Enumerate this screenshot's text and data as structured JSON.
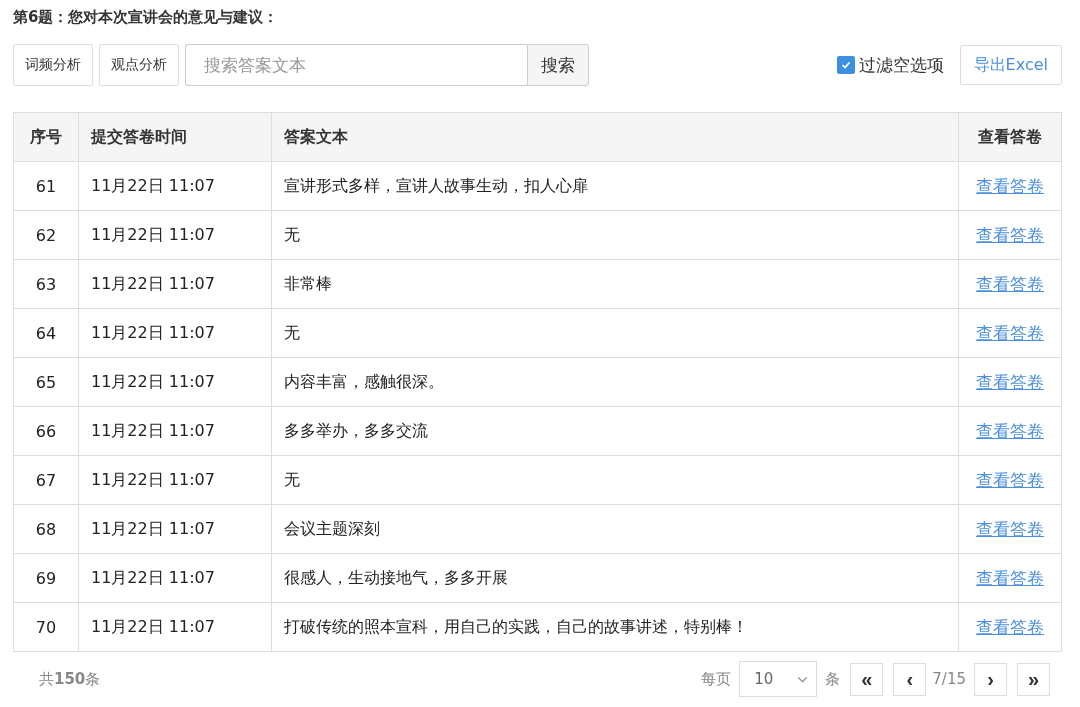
{
  "question_title": "第6题：您对本次宣讲会的意见与建议：",
  "toolbar": {
    "buttons": [
      "词频分析",
      "观点分析"
    ],
    "search": {
      "placeholder": "搜索答案文本",
      "button": "搜索"
    },
    "filter": {
      "label": "过滤空选项",
      "checked": true
    },
    "export_button": "导出Excel"
  },
  "table": {
    "columns": [
      "序号",
      "提交答卷时间",
      "答案文本",
      "查看答卷"
    ],
    "rows": [
      {
        "index": "61",
        "time": "11月22日 11:07",
        "answer": "宣讲形式多样，宣讲人故事生动，扣人心扉",
        "link": "查看答卷"
      },
      {
        "index": "62",
        "time": "11月22日 11:07",
        "answer": "无",
        "link": "查看答卷"
      },
      {
        "index": "63",
        "time": "11月22日 11:07",
        "answer": "非常棒",
        "link": "查看答卷"
      },
      {
        "index": "64",
        "time": "11月22日 11:07",
        "answer": "无",
        "link": "查看答卷"
      },
      {
        "index": "65",
        "time": "11月22日 11:07",
        "answer": "内容丰富，感触很深。",
        "link": "查看答卷"
      },
      {
        "index": "66",
        "time": "11月22日 11:07",
        "answer": "多多举办，多多交流",
        "link": "查看答卷"
      },
      {
        "index": "67",
        "time": "11月22日 11:07",
        "answer": "无",
        "link": "查看答卷"
      },
      {
        "index": "68",
        "time": "11月22日 11:07",
        "answer": "会议主题深刻",
        "link": "查看答卷"
      },
      {
        "index": "69",
        "time": "11月22日 11:07",
        "answer": "很感人，生动接地气，多多开展",
        "link": "查看答卷"
      },
      {
        "index": "70",
        "time": "11月22日 11:07",
        "answer": "打破传统的照本宣科，用自己的实践，自己的故事讲述，特别棒！",
        "link": "查看答卷"
      }
    ]
  },
  "footer": {
    "total": "共**150**条",
    "per_page_label": "每页",
    "per_page": "10",
    "per_page_unit": "条",
    "page": "7/15",
    "first": "«",
    "prev": "‹",
    "next": "›",
    "last": "»"
  }
}
